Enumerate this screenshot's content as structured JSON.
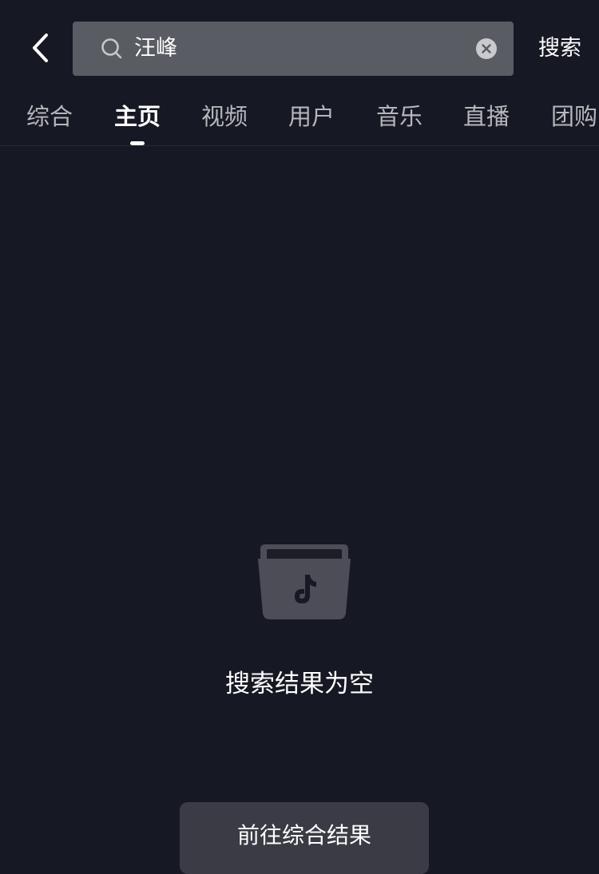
{
  "header": {
    "back_icon": "chevron-left-icon",
    "search": {
      "icon": "search-icon",
      "value": "汪峰",
      "clear_icon": "clear-circle-icon"
    },
    "submit_label": "搜索"
  },
  "tabs": [
    {
      "label": "综合",
      "active": false
    },
    {
      "label": "主页",
      "active": true
    },
    {
      "label": "视频",
      "active": false
    },
    {
      "label": "用户",
      "active": false
    },
    {
      "label": "音乐",
      "active": false
    },
    {
      "label": "直播",
      "active": false
    },
    {
      "label": "团购",
      "active": false
    }
  ],
  "empty_state": {
    "icon": "tiktok-folder-icon",
    "message": "搜索结果为空",
    "button_label": "前往综合结果"
  },
  "colors": {
    "background": "#161823",
    "search_box": "#5a5c64",
    "button": "#3a3b44",
    "tab_inactive": "#b6b7bc",
    "text": "#ffffff"
  }
}
